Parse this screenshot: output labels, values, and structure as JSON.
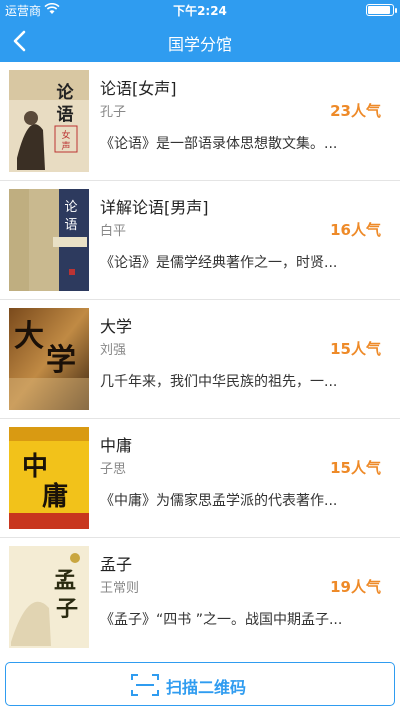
{
  "status_bar": {
    "carrier": "运营商",
    "time": "下午2:24",
    "wifi_icon": "wifi-icon",
    "battery_icon": "battery-icon",
    "battery_level": 0.9
  },
  "nav": {
    "title": "国学分馆",
    "back_icon": "chevron-left-icon"
  },
  "books": [
    {
      "title": "论语[女声]",
      "author": "孔子",
      "popularity": "23人气",
      "description": "《论语》是一部语录体思想散文集。..."
    },
    {
      "title": "详解论语[男声]",
      "author": "白平",
      "popularity": "16人气",
      "description": "《论语》是儒学经典著作之一，时贤..."
    },
    {
      "title": "大学",
      "author": "刘强",
      "popularity": "15人气",
      "description": "几千年来，我们中华民族的祖先，一..."
    },
    {
      "title": "中庸",
      "author": "子思",
      "popularity": "15人气",
      "description": "《中庸》为儒家思孟学派的代表著作..."
    },
    {
      "title": "孟子",
      "author": "王常则",
      "popularity": "19人气",
      "description": "《孟子》“四书 ”之一。战国中期孟子..."
    }
  ],
  "bottom": {
    "scan_label": "扫描二维码",
    "scan_icon": "qr-scan-icon"
  },
  "colors": {
    "accent": "#2f9cf0",
    "popularity": "#ee8a28"
  }
}
